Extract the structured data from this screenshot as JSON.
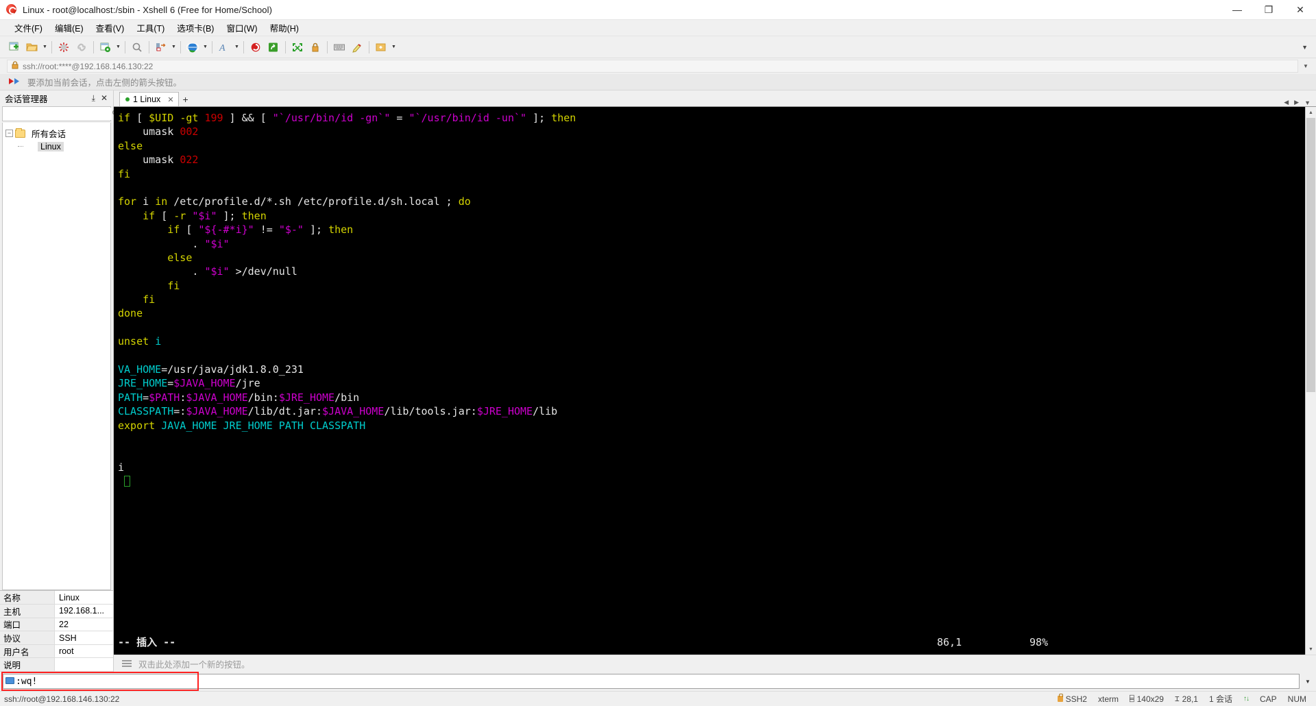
{
  "window": {
    "title": "Linux - root@localhost:/sbin - Xshell 6 (Free for Home/School)",
    "app_icon": "xshell-icon",
    "minimize": "—",
    "maximize": "❐",
    "close": "✕"
  },
  "menu": {
    "items": [
      {
        "label": "文件(F)",
        "name": "menu-file"
      },
      {
        "label": "编辑(E)",
        "name": "menu-edit"
      },
      {
        "label": "查看(V)",
        "name": "menu-view"
      },
      {
        "label": "工具(T)",
        "name": "menu-tools"
      },
      {
        "label": "选项卡(B)",
        "name": "menu-tabs"
      },
      {
        "label": "窗口(W)",
        "name": "menu-window"
      },
      {
        "label": "帮助(H)",
        "name": "menu-help"
      }
    ]
  },
  "toolbar": {
    "overflow_chevron": "▼",
    "buttons": [
      {
        "name": "new-session-icon",
        "glyph": "❐"
      },
      {
        "name": "open-folder-icon",
        "glyph": "▰"
      },
      {
        "name": "disconnect-icon",
        "glyph": "✂"
      },
      {
        "name": "reconnect-icon",
        "glyph": "⚭"
      },
      {
        "name": "session-properties-icon",
        "glyph": "⚙"
      },
      {
        "name": "find-icon",
        "glyph": "⚲"
      },
      {
        "name": "transfer-icon",
        "glyph": "⇄"
      },
      {
        "name": "globe-icon",
        "glyph": "●"
      },
      {
        "name": "font-icon",
        "glyph": "A"
      },
      {
        "name": "xshell-icon",
        "glyph": "●"
      },
      {
        "name": "xftp-icon",
        "glyph": "■"
      },
      {
        "name": "fullscreen-icon",
        "glyph": "⤡"
      },
      {
        "name": "lock-icon",
        "glyph": "⚿"
      },
      {
        "name": "keyboard-icon",
        "glyph": "⌨"
      },
      {
        "name": "highlight-icon",
        "glyph": "✎"
      },
      {
        "name": "add-note-icon",
        "glyph": "⬚"
      }
    ]
  },
  "address": {
    "lock_icon": "lock-icon",
    "url": "ssh://root:****@192.168.146.130:22",
    "caret": "▼"
  },
  "hint": {
    "icon": "arrow-hint-icon",
    "text": "要添加当前会话，点击左侧的箭头按钮。"
  },
  "sidebar": {
    "title": "会话管理器",
    "pin": "⤓",
    "close": "✕",
    "search_placeholder": "",
    "search_value": "",
    "tree": {
      "root": {
        "label": "所有会话",
        "expander": "−"
      },
      "children": [
        {
          "label": "Linux",
          "selected": true
        }
      ]
    },
    "properties": [
      {
        "key": "名称",
        "value": "Linux"
      },
      {
        "key": "主机",
        "value": "192.168.1..."
      },
      {
        "key": "端口",
        "value": "22"
      },
      {
        "key": "协议",
        "value": "SSH"
      },
      {
        "key": "用户名",
        "value": "root"
      },
      {
        "key": "说明",
        "value": ""
      }
    ]
  },
  "tabs": {
    "items": [
      {
        "label": "1 Linux",
        "close": "✕",
        "active": true
      }
    ],
    "add_label": "+",
    "nav_left": "◀",
    "nav_right": "▶",
    "nav_menu": "▼"
  },
  "terminal": {
    "lines": [
      [
        {
          "t": "if",
          "c": "k"
        },
        {
          "t": " [ ",
          "c": "w"
        },
        {
          "t": "$UID",
          "c": "k"
        },
        {
          "t": " ",
          "c": "w"
        },
        {
          "t": "-gt",
          "c": "k"
        },
        {
          "t": " ",
          "c": "w"
        },
        {
          "t": "199",
          "c": "n"
        },
        {
          "t": " ] ",
          "c": "w"
        },
        {
          "t": "&&",
          "c": "w"
        },
        {
          "t": " [ ",
          "c": "w"
        },
        {
          "t": "\"`/usr/bin/id -gn`\"",
          "c": "s"
        },
        {
          "t": " = ",
          "c": "w"
        },
        {
          "t": "\"`/usr/bin/id -un`\"",
          "c": "s"
        },
        {
          "t": " ]; ",
          "c": "w"
        },
        {
          "t": "then",
          "c": "k"
        }
      ],
      [
        {
          "t": "    umask ",
          "c": "w"
        },
        {
          "t": "002",
          "c": "n"
        }
      ],
      [
        {
          "t": "else",
          "c": "k"
        }
      ],
      [
        {
          "t": "    umask ",
          "c": "w"
        },
        {
          "t": "022",
          "c": "n"
        }
      ],
      [
        {
          "t": "fi",
          "c": "k"
        }
      ],
      [],
      [
        {
          "t": "for",
          "c": "k"
        },
        {
          "t": " i ",
          "c": "w"
        },
        {
          "t": "in",
          "c": "k"
        },
        {
          "t": " /etc/profile.d/*.sh /etc/profile.d/sh.local ; ",
          "c": "w"
        },
        {
          "t": "do",
          "c": "k"
        }
      ],
      [
        {
          "t": "    ",
          "c": "w"
        },
        {
          "t": "if",
          "c": "k"
        },
        {
          "t": " [ ",
          "c": "w"
        },
        {
          "t": "-r",
          "c": "k"
        },
        {
          "t": " ",
          "c": "w"
        },
        {
          "t": "\"$i\"",
          "c": "s"
        },
        {
          "t": " ]; ",
          "c": "w"
        },
        {
          "t": "then",
          "c": "k"
        }
      ],
      [
        {
          "t": "        ",
          "c": "w"
        },
        {
          "t": "if",
          "c": "k"
        },
        {
          "t": " [ ",
          "c": "w"
        },
        {
          "t": "\"${-#*i}\"",
          "c": "s"
        },
        {
          "t": " != ",
          "c": "w"
        },
        {
          "t": "\"$-\"",
          "c": "s"
        },
        {
          "t": " ]; ",
          "c": "w"
        },
        {
          "t": "then",
          "c": "k"
        }
      ],
      [
        {
          "t": "            . ",
          "c": "w"
        },
        {
          "t": "\"$i\"",
          "c": "s"
        }
      ],
      [
        {
          "t": "        ",
          "c": "w"
        },
        {
          "t": "else",
          "c": "k"
        }
      ],
      [
        {
          "t": "            . ",
          "c": "w"
        },
        {
          "t": "\"$i\"",
          "c": "s"
        },
        {
          "t": " >/dev/null",
          "c": "w"
        }
      ],
      [
        {
          "t": "        ",
          "c": "w"
        },
        {
          "t": "fi",
          "c": "k"
        }
      ],
      [
        {
          "t": "    ",
          "c": "w"
        },
        {
          "t": "fi",
          "c": "k"
        }
      ],
      [
        {
          "t": "done",
          "c": "k"
        }
      ],
      [],
      [
        {
          "t": "unset",
          "c": "k"
        },
        {
          "t": " ",
          "c": "w"
        },
        {
          "t": "i",
          "c": "c"
        }
      ],
      [],
      [
        {
          "t": "VA_HOME",
          "c": "c"
        },
        {
          "t": "=/usr/java/jdk1.8.0_231",
          "c": "w"
        }
      ],
      [
        {
          "t": "JRE_HOME",
          "c": "c"
        },
        {
          "t": "=",
          "c": "w"
        },
        {
          "t": "$JAVA_HOME",
          "c": "s"
        },
        {
          "t": "/jre",
          "c": "w"
        }
      ],
      [
        {
          "t": "PATH",
          "c": "c"
        },
        {
          "t": "=",
          "c": "w"
        },
        {
          "t": "$PATH",
          "c": "s"
        },
        {
          "t": ":",
          "c": "w"
        },
        {
          "t": "$JAVA_HOME",
          "c": "s"
        },
        {
          "t": "/bin:",
          "c": "w"
        },
        {
          "t": "$JRE_HOME",
          "c": "s"
        },
        {
          "t": "/bin",
          "c": "w"
        }
      ],
      [
        {
          "t": "CLASSPATH",
          "c": "c"
        },
        {
          "t": "=:",
          "c": "w"
        },
        {
          "t": "$JAVA_HOME",
          "c": "s"
        },
        {
          "t": "/lib/dt.jar:",
          "c": "w"
        },
        {
          "t": "$JAVA_HOME",
          "c": "s"
        },
        {
          "t": "/lib/tools.jar:",
          "c": "w"
        },
        {
          "t": "$JRE_HOME",
          "c": "s"
        },
        {
          "t": "/lib",
          "c": "w"
        }
      ],
      [
        {
          "t": "export",
          "c": "k"
        },
        {
          "t": " ",
          "c": "w"
        },
        {
          "t": "JAVA_HOME JRE_HOME PATH CLASSPATH",
          "c": "c"
        }
      ],
      [],
      [],
      [
        {
          "t": "i",
          "c": "w"
        }
      ],
      []
    ],
    "cursor_row": 26,
    "status": {
      "mode": "-- 插入 --",
      "position": "86,1",
      "percent": "98%"
    }
  },
  "quickbar": {
    "icon": "hamburger-icon",
    "text": "双击此处添加一个新的按钮。"
  },
  "command": {
    "icon": "keyboard-icon",
    "value": ":wq!",
    "caret": "▼",
    "highlighted": true
  },
  "statusbar": {
    "connection": "ssh://root@192.168.146.130:22",
    "items": [
      {
        "name": "protocol",
        "label": "SSH2",
        "icon": "lock-icon"
      },
      {
        "name": "terminal-type",
        "label": "xterm"
      },
      {
        "name": "screen-size",
        "label": "140x29",
        "icon": "size-icon"
      },
      {
        "name": "cursor-pos",
        "label": "28,1",
        "icon": "cursor-icon"
      },
      {
        "name": "session-count",
        "label": "1 会话"
      },
      {
        "name": "traffic",
        "label": "",
        "icon": "updown-arrows-icon"
      },
      {
        "name": "cap-lock",
        "label": "CAP"
      },
      {
        "name": "num-lock",
        "label": "NUM"
      }
    ]
  },
  "colors": {
    "keyword": "#d4d400",
    "number": "#cc0000",
    "string": "#cd00cd",
    "cyan": "#00cdcd",
    "plain": "#e6e6e6",
    "highlight_box": "#ff2020",
    "tab_dot": "#2aa02a"
  }
}
